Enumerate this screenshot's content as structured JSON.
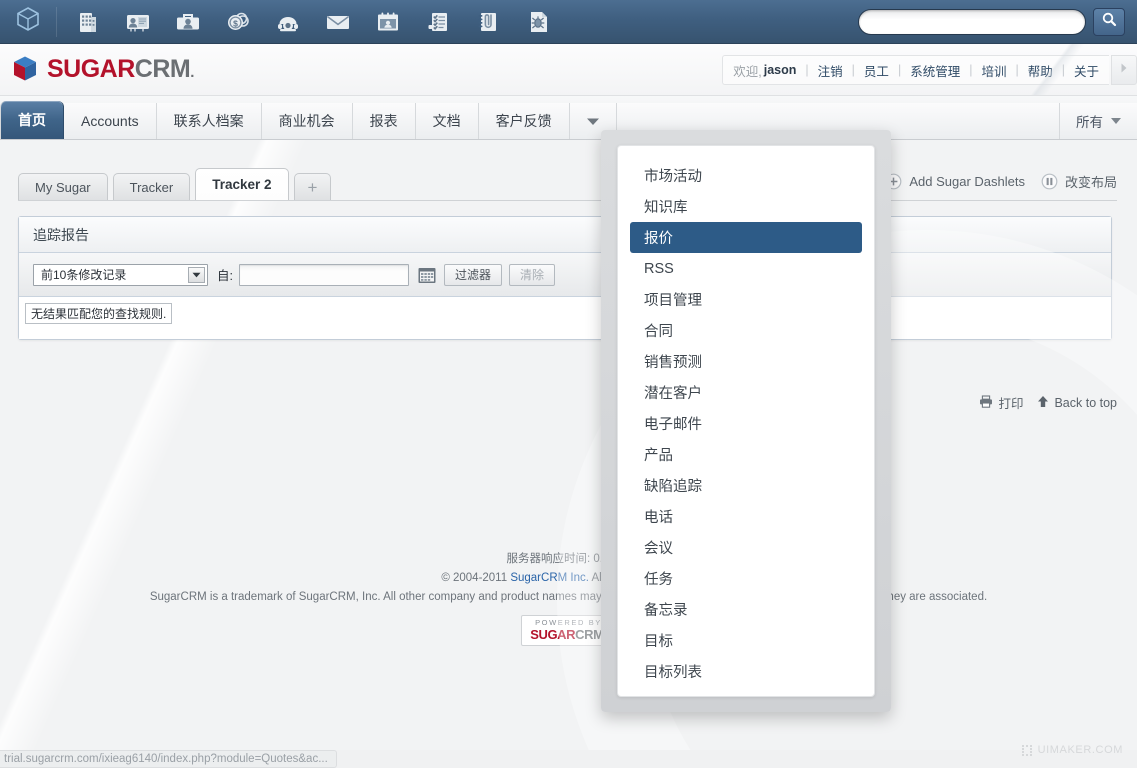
{
  "topbar": {
    "home_icon": "cube-icon",
    "icons": [
      {
        "name": "accounts-icon",
        "title": "Accounts"
      },
      {
        "name": "contacts-icon",
        "title": "Contacts"
      },
      {
        "name": "opportunities-icon",
        "title": "Opportunities"
      },
      {
        "name": "money-icon",
        "title": "Quotes"
      },
      {
        "name": "phone-icon",
        "title": "Calls"
      },
      {
        "name": "email-icon",
        "title": "Emails"
      },
      {
        "name": "calendar-icon",
        "title": "Calendar"
      },
      {
        "name": "tasks-icon",
        "title": "Tasks"
      },
      {
        "name": "notes-icon",
        "title": "Notes"
      },
      {
        "name": "bugs-icon",
        "title": "Bugs"
      }
    ],
    "search_value": "",
    "search_placeholder": "",
    "search_button_icon": "search-icon"
  },
  "header": {
    "logo_sugar": "SUGAR",
    "logo_crm": "CRM",
    "logo_dot": ".",
    "welcome_label": "欢迎,",
    "user_name": "jason",
    "links": [
      "注销",
      "员工",
      "系统管理",
      "培训",
      "帮助",
      "关于"
    ],
    "more_arrow_icon": "chevron-right-icon"
  },
  "nav": {
    "tabs": [
      {
        "label": "首页",
        "active": true
      },
      {
        "label": "Accounts",
        "active": false
      },
      {
        "label": "联系人档案",
        "active": false
      },
      {
        "label": "商业机会",
        "active": false
      },
      {
        "label": "报表",
        "active": false
      },
      {
        "label": "文档",
        "active": false
      },
      {
        "label": "客户反馈",
        "active": false
      }
    ],
    "dropdown_icon": "chevron-down-icon",
    "all_label": "所有"
  },
  "dashboard": {
    "tabs": [
      {
        "label": "My Sugar",
        "active": false
      },
      {
        "label": "Tracker",
        "active": false
      },
      {
        "label": "Tracker 2",
        "active": true
      }
    ],
    "add_tab_label": "+",
    "add_dashlets_label": "Add Sugar Dashlets",
    "add_dashlets_icon": "plus-circle-icon",
    "change_layout_label": "改变布局",
    "change_layout_icon": "columns-icon"
  },
  "panel": {
    "title": "追踪报告",
    "select_value": "前10条修改记录",
    "select_arrow_icon": "chevron-down-icon",
    "from_label": "自:",
    "date_value": "",
    "date_placeholder": "",
    "calendar_icon": "calendar-icon",
    "filter_button": "过滤器",
    "clear_button": "清除",
    "empty_message": "无结果匹配您的查找规则."
  },
  "menu": {
    "items": [
      {
        "label": "市场活动",
        "selected": false
      },
      {
        "label": "知识库",
        "selected": false
      },
      {
        "label": "报价",
        "selected": true
      },
      {
        "label": "RSS",
        "selected": false
      },
      {
        "label": "项目管理",
        "selected": false
      },
      {
        "label": "合同",
        "selected": false
      },
      {
        "label": "销售预测",
        "selected": false
      },
      {
        "label": "潜在客户",
        "selected": false
      },
      {
        "label": "电子邮件",
        "selected": false
      },
      {
        "label": "产品",
        "selected": false
      },
      {
        "label": "缺陷追踪",
        "selected": false
      },
      {
        "label": "电话",
        "selected": false
      },
      {
        "label": "会议",
        "selected": false
      },
      {
        "label": "任务",
        "selected": false
      },
      {
        "label": "备忘录",
        "selected": false
      },
      {
        "label": "目标",
        "selected": false
      },
      {
        "label": "目标列表",
        "selected": false
      }
    ]
  },
  "page_actions": {
    "print_label": "打印",
    "print_icon": "printer-icon",
    "back_to_top_label": "Back to top",
    "back_to_top_icon": "arrow-up-icon"
  },
  "footer": {
    "server_time": "服务器响应时间: 0.20 秒",
    "copyright_prefix": "© 2004-2011 ",
    "copyright_link": "SugarCRM Inc.",
    "copyright_suffix": " All Rights Reserved.",
    "trademark": "SugarCRM is a trademark of SugarCRM, Inc. All other company and product names may be trademarks of the respective companies with which they are associated.",
    "powered_top": "POWERED BY",
    "powered_sugar": "SUGAR",
    "powered_crm": "CRM",
    "powered_dot": "."
  },
  "statusbar": {
    "url": "trial.sugarcrm.com/ixieag6140/index.php?module=Quotes&ac...",
    "watermark": "UIMAKER.COM",
    "watermark_icon": "uimaker-icon"
  },
  "colors": {
    "topbar_blue": "#3f5f80",
    "accent_blue": "#2d5b87",
    "logo_red": "#b3122b",
    "logo_gray": "#6b6f73",
    "link_blue": "#2a64a8"
  }
}
